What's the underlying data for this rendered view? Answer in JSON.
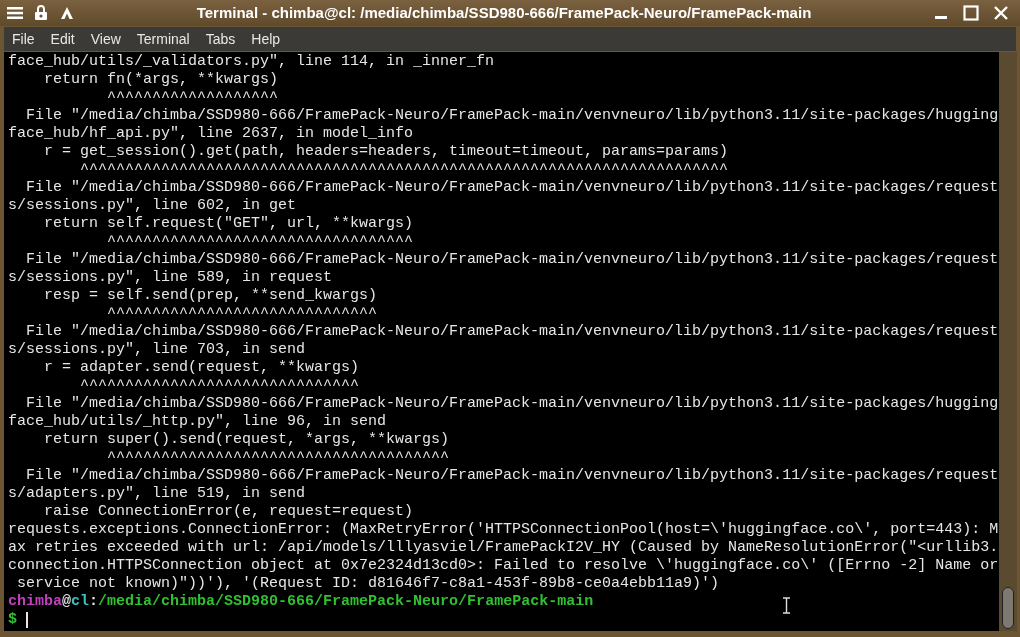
{
  "window": {
    "title": "Terminal - chimba@cl: /media/chimba/SSD980-666/FramePack-Neuro/FramePack-main"
  },
  "menu": [
    "File",
    "Edit",
    "View",
    "Terminal",
    "Tabs",
    "Help"
  ],
  "terminal": {
    "lines": [
      "face_hub/utils/_validators.py\", line 114, in _inner_fn",
      "    return fn(*args, **kwargs)",
      "           ^^^^^^^^^^^^^^^^^^^",
      "  File \"/media/chimba/SSD980-666/FramePack-Neuro/FramePack-main/venvneuro/lib/python3.11/site-packages/hugging",
      "face_hub/hf_api.py\", line 2637, in model_info",
      "    r = get_session().get(path, headers=headers, timeout=timeout, params=params)",
      "        ^^^^^^^^^^^^^^^^^^^^^^^^^^^^^^^^^^^^^^^^^^^^^^^^^^^^^^^^^^^^^^^^^^^^^^^^",
      "  File \"/media/chimba/SSD980-666/FramePack-Neuro/FramePack-main/venvneuro/lib/python3.11/site-packages/request",
      "s/sessions.py\", line 602, in get",
      "    return self.request(\"GET\", url, **kwargs)",
      "           ^^^^^^^^^^^^^^^^^^^^^^^^^^^^^^^^^^",
      "  File \"/media/chimba/SSD980-666/FramePack-Neuro/FramePack-main/venvneuro/lib/python3.11/site-packages/request",
      "s/sessions.py\", line 589, in request",
      "    resp = self.send(prep, **send_kwargs)",
      "           ^^^^^^^^^^^^^^^^^^^^^^^^^^^^^^",
      "  File \"/media/chimba/SSD980-666/FramePack-Neuro/FramePack-main/venvneuro/lib/python3.11/site-packages/request",
      "s/sessions.py\", line 703, in send",
      "    r = adapter.send(request, **kwargs)",
      "        ^^^^^^^^^^^^^^^^^^^^^^^^^^^^^^^",
      "  File \"/media/chimba/SSD980-666/FramePack-Neuro/FramePack-main/venvneuro/lib/python3.11/site-packages/hugging",
      "face_hub/utils/_http.py\", line 96, in send",
      "    return super().send(request, *args, **kwargs)",
      "           ^^^^^^^^^^^^^^^^^^^^^^^^^^^^^^^^^^^^^^",
      "  File \"/media/chimba/SSD980-666/FramePack-Neuro/FramePack-main/venvneuro/lib/python3.11/site-packages/request",
      "s/adapters.py\", line 519, in send",
      "    raise ConnectionError(e, request=request)",
      "requests.exceptions.ConnectionError: (MaxRetryError('HTTPSConnectionPool(host=\\'huggingface.co\\', port=443): M",
      "ax retries exceeded with url: /api/models/lllyasviel/FramePackI2V_HY (Caused by NameResolutionError(\"<urllib3.",
      "connection.HTTPSConnection object at 0x7e2324d13cd0>: Failed to resolve \\'huggingface.co\\' ([Errno -2] Name or",
      " service not known)\"))'), '(Request ID: d81646f7-c8a1-453f-89b8-ce0a4ebb11a9)')"
    ],
    "prompt": [
      {
        "kind": "user",
        "text": "chimba"
      },
      {
        "kind": "plain",
        "text": "@"
      },
      {
        "kind": "host",
        "text": "cl"
      },
      {
        "kind": "plain",
        "text": ":"
      },
      {
        "kind": "path",
        "text": "/media/chimba/SSD980-666/FramePack-Neuro/FramePack-main"
      }
    ],
    "input_prompt": "$"
  }
}
